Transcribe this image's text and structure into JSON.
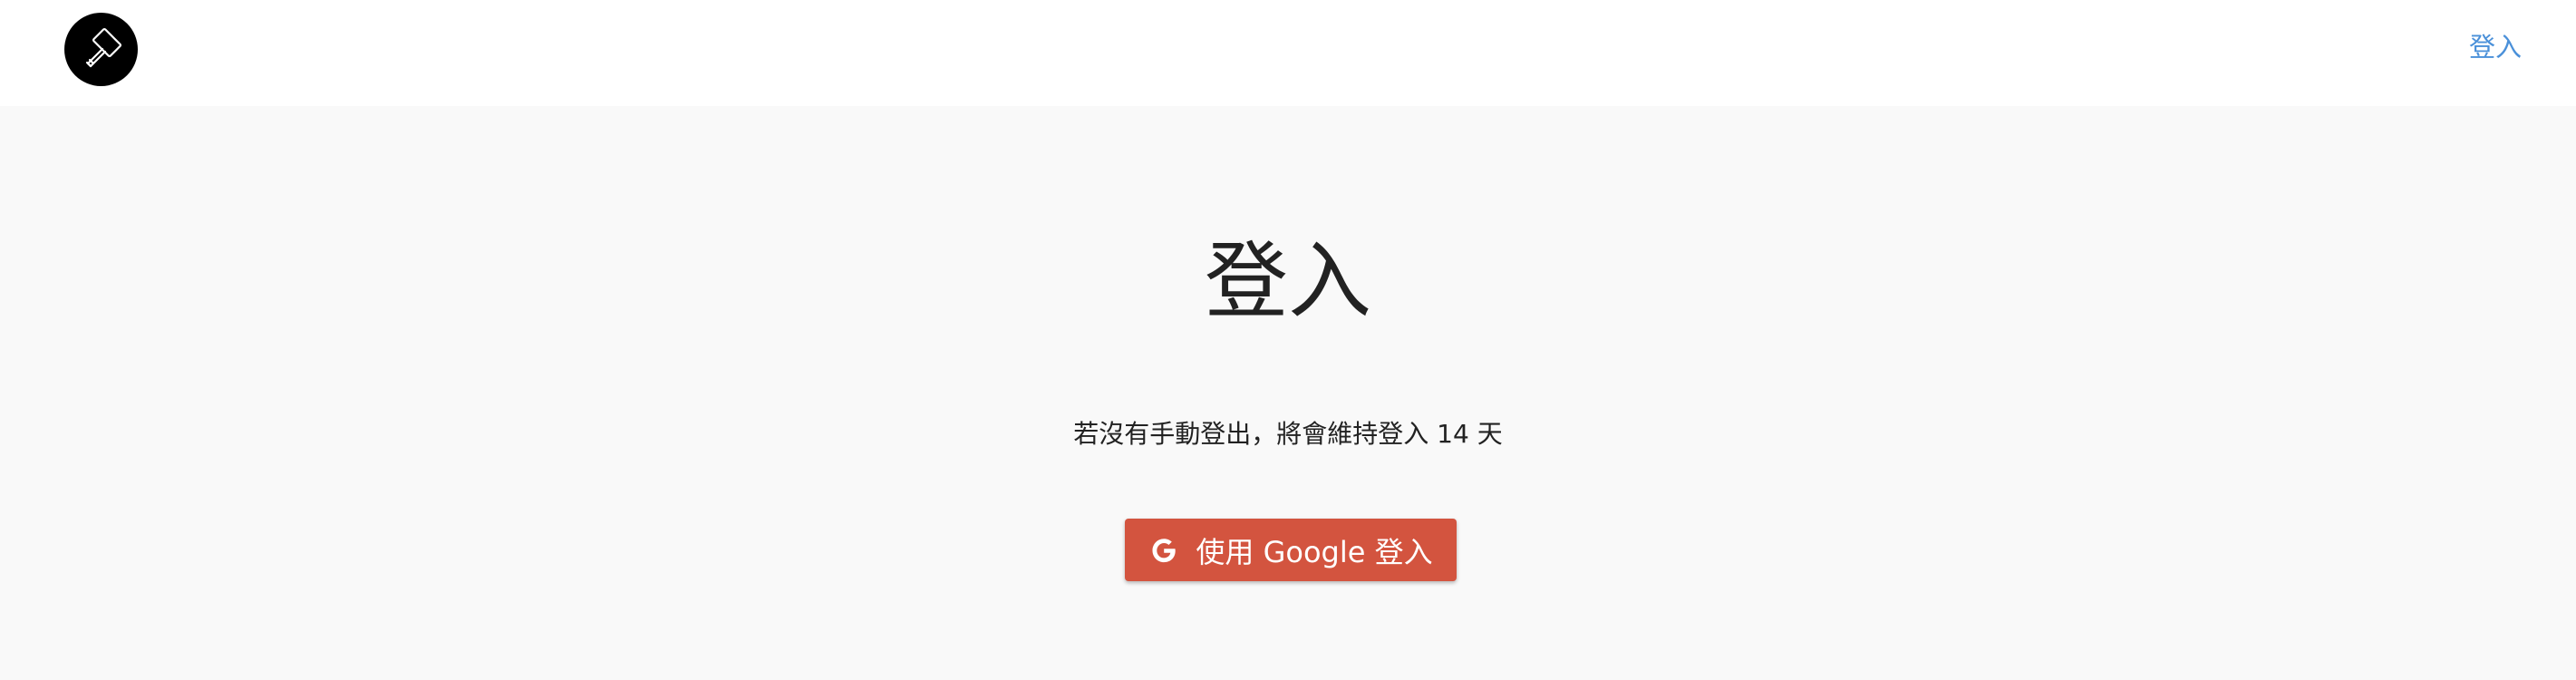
{
  "header": {
    "logo_icon": "hammer-icon",
    "login_link": "登入",
    "link_color": "#4a90d9"
  },
  "main": {
    "title": "登入",
    "subtitle": "若沒有手動登出，將會維持登入 14 天",
    "google_button": {
      "icon": "google-g-icon",
      "label": "使用 Google 登入",
      "color": "#d3543f"
    }
  }
}
